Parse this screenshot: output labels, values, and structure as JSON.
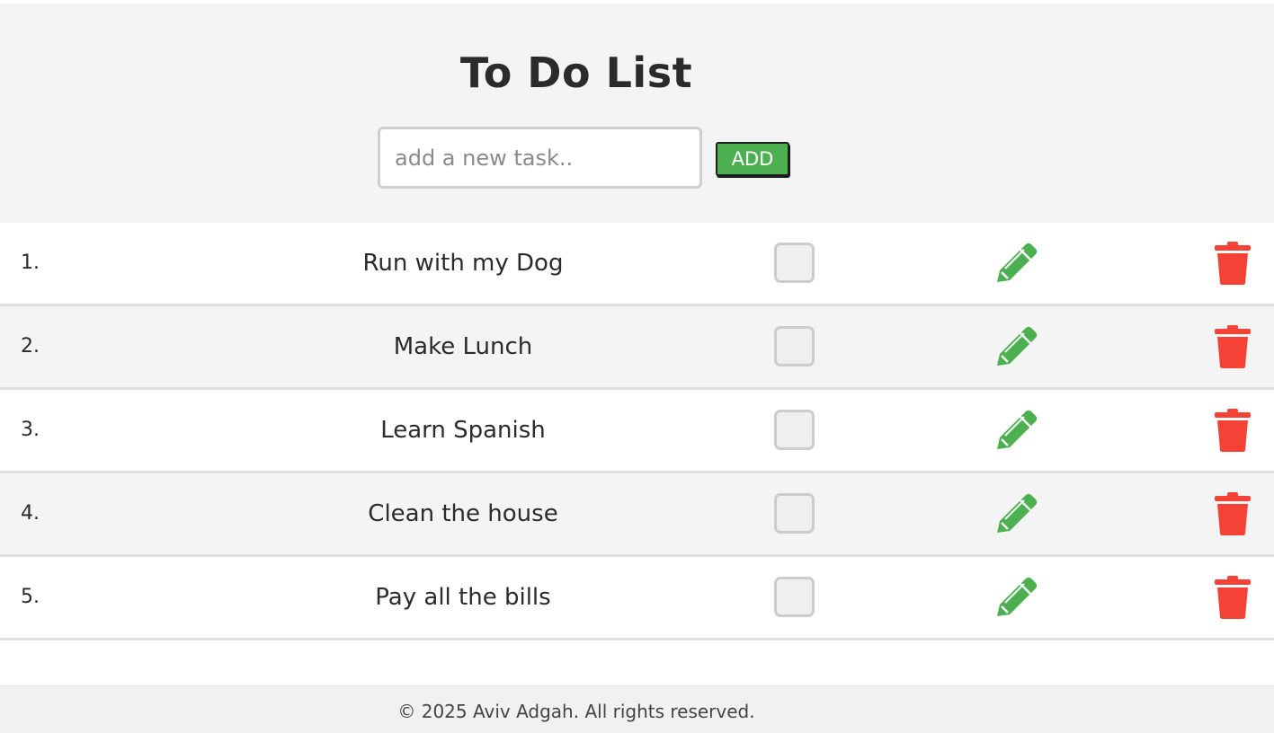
{
  "header": {
    "title": "To Do List",
    "input_placeholder": "add a new task..",
    "input_value": "",
    "add_label": "ADD"
  },
  "tasks": [
    {
      "number": "1.",
      "text": "Run with my Dog",
      "done": false
    },
    {
      "number": "2.",
      "text": "Make Lunch",
      "done": false
    },
    {
      "number": "3.",
      "text": "Learn Spanish",
      "done": false
    },
    {
      "number": "4.",
      "text": "Clean the house",
      "done": false
    },
    {
      "number": "5.",
      "text": "Pay all the bills",
      "done": false
    }
  ],
  "icons": {
    "edit": "pencil-icon",
    "delete": "trash-icon"
  },
  "colors": {
    "accent_green": "#4caf50",
    "delete_red": "#f44336",
    "header_bg": "#f4f4f4"
  },
  "footer": {
    "text": "© 2025 Aviv Adgah. All rights reserved."
  }
}
